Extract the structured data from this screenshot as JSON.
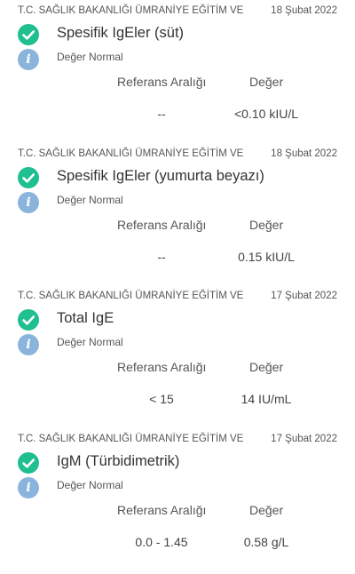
{
  "results": [
    {
      "hospital": "T.C. SAĞLIK BAKANLIĞI ÜMRANİYE EĞİTİM VE",
      "date": "18 Şubat 2022",
      "test_name": "Spesifik IgEler (süt)",
      "status": "Değer Normal",
      "ref_header": "Referans Aralığı",
      "value_header": "Değer",
      "ref_range": "--",
      "value": "<0.10 kIU/L"
    },
    {
      "hospital": "T.C. SAĞLIK BAKANLIĞI ÜMRANİYE EĞİTİM VE",
      "date": "18 Şubat 2022",
      "test_name": "Spesifik IgEler (yumurta beyazı)",
      "status": "Değer Normal",
      "ref_header": "Referans Aralığı",
      "value_header": "Değer",
      "ref_range": "--",
      "value": "0.15 kIU/L"
    },
    {
      "hospital": "T.C. SAĞLIK BAKANLIĞI ÜMRANİYE EĞİTİM VE",
      "date": "17 Şubat 2022",
      "test_name": "Total IgE",
      "status": "Değer Normal",
      "ref_header": "Referans Aralığı",
      "value_header": "Değer",
      "ref_range": "< 15",
      "value": "14 IU/mL"
    },
    {
      "hospital": "T.C. SAĞLIK BAKANLIĞI ÜMRANİYE EĞİTİM VE",
      "date": "17 Şubat 2022",
      "test_name": "IgM (Türbidimetrik)",
      "status": "Değer Normal",
      "ref_header": "Referans Aralığı",
      "value_header": "Değer",
      "ref_range": "0.0 - 1.45",
      "value": "0.58 g/L"
    }
  ],
  "icons": {
    "check": "check-circle-icon",
    "info": "info-icon"
  },
  "colors": {
    "check_green": "#1fbf8f",
    "info_blue": "#8ab4dc",
    "text": "#333333",
    "muted": "#555555"
  }
}
